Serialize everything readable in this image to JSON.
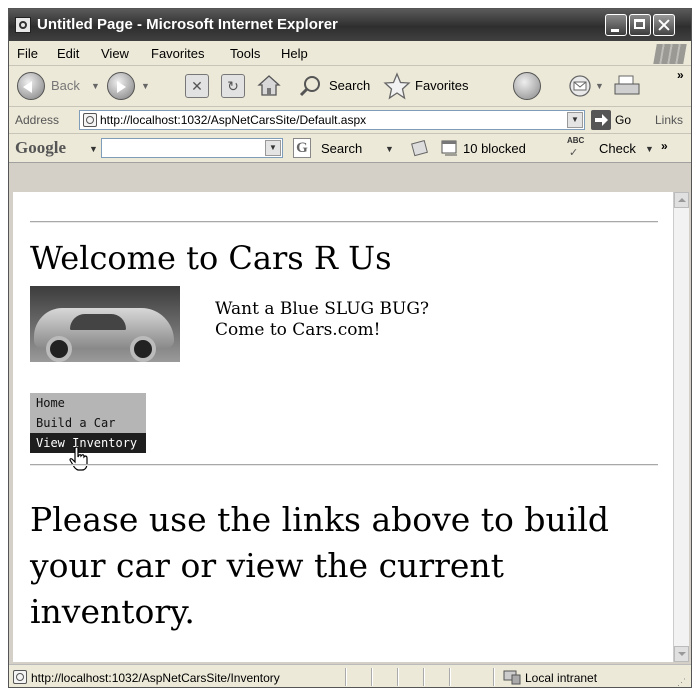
{
  "window": {
    "title": "Untitled Page - Microsoft Internet Explorer"
  },
  "menu": [
    "File",
    "Edit",
    "View",
    "Favorites",
    "Tools",
    "Help"
  ],
  "toolbar": {
    "back_label": "Back",
    "search_label": "Search",
    "favorites_label": "Favorites",
    "more_label": "»"
  },
  "address": {
    "label": "Address",
    "url": "http://localhost:1032/AspNetCarsSite/Default.aspx",
    "go_label": "Go",
    "links_label": "Links"
  },
  "google": {
    "logo": "Google",
    "search_label": "Search",
    "blocked_label": "10 blocked",
    "abc_label": "ABC",
    "check_label": "Check",
    "more_label": "»"
  },
  "page": {
    "heading": "Welcome to Cars R Us",
    "promo_line1": "Want a Blue SLUG BUG?",
    "promo_line2": "Come to Cars.com!",
    "nav": [
      {
        "label": "Home",
        "active": false
      },
      {
        "label": "Build a Car",
        "active": false
      },
      {
        "label": "View Inventory",
        "active": true
      }
    ],
    "message": "Please use the links above to build your car or view the current inventory."
  },
  "status": {
    "url": "http://localhost:1032/AspNetCarsSite/Inventory",
    "zone": "Local intranet"
  }
}
